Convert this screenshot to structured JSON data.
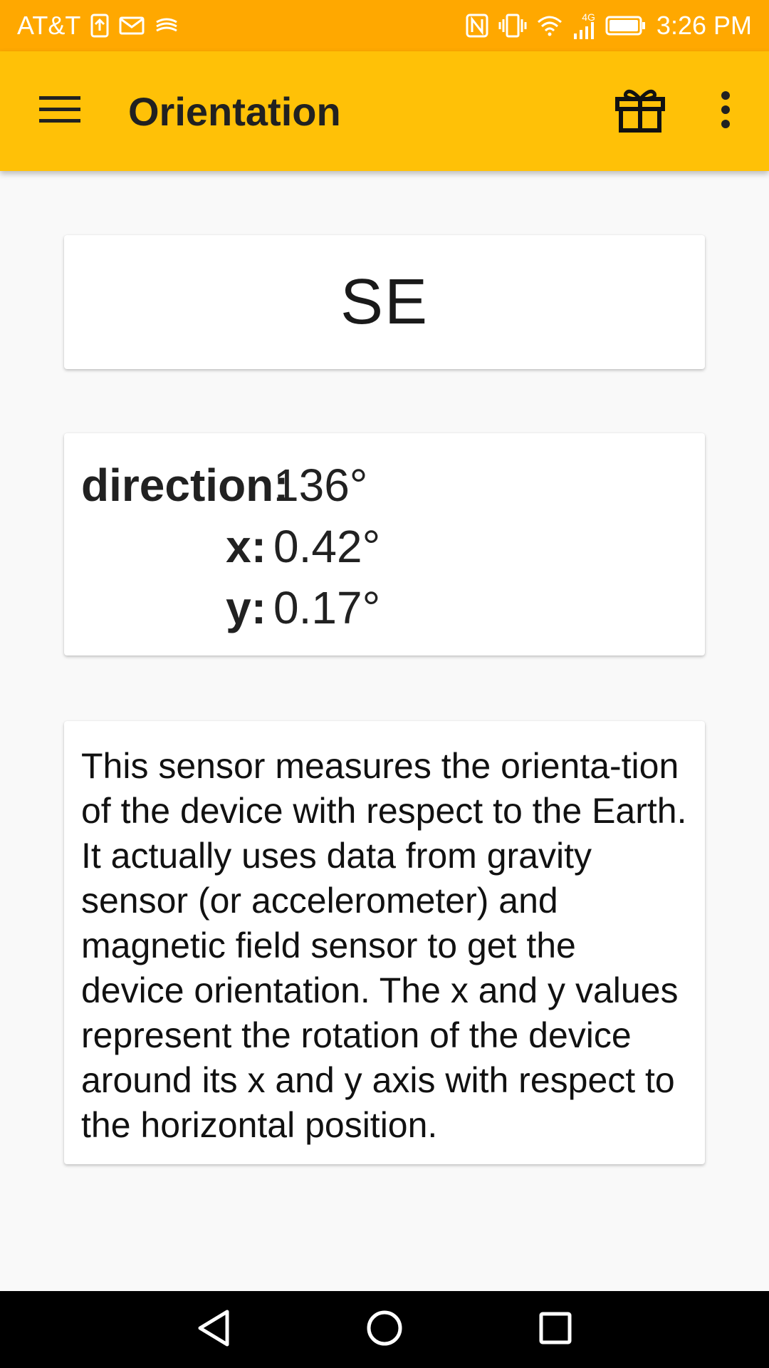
{
  "status_bar": {
    "carrier": "AT&T",
    "network": "4G",
    "time": "3:26 PM",
    "icons": [
      "upload-icon",
      "mail-icon",
      "swype-icon",
      "nfc-icon",
      "vibrate-icon",
      "wifi-icon",
      "signal-icon",
      "battery-icon"
    ]
  },
  "toolbar": {
    "title": "Orientation",
    "menu_icon": "hamburger-menu-icon",
    "gift_icon": "gift-icon",
    "overflow_icon": "more-vert-icon"
  },
  "heading": {
    "value": "SE"
  },
  "values": {
    "rows": [
      {
        "label": "direction:",
        "value": "136°"
      },
      {
        "label": "x:",
        "value": "0.42°"
      },
      {
        "label": "y:",
        "value": "0.17°"
      }
    ]
  },
  "description": {
    "text": "This sensor measures the orienta-tion of the device with respect to the Earth. It actually uses data from gravity sensor (or accelerometer) and magnetic field sensor to get the device orientation. The x and y values represent the rotation of the device around its x and y axis with respect to the horizontal position."
  },
  "nav_bar": {
    "icons": [
      "back-icon",
      "home-icon",
      "recents-icon"
    ]
  },
  "colors": {
    "status_bar": "#ffa800",
    "toolbar": "#ffc107",
    "background": "#f9f9f9",
    "card": "#ffffff"
  }
}
